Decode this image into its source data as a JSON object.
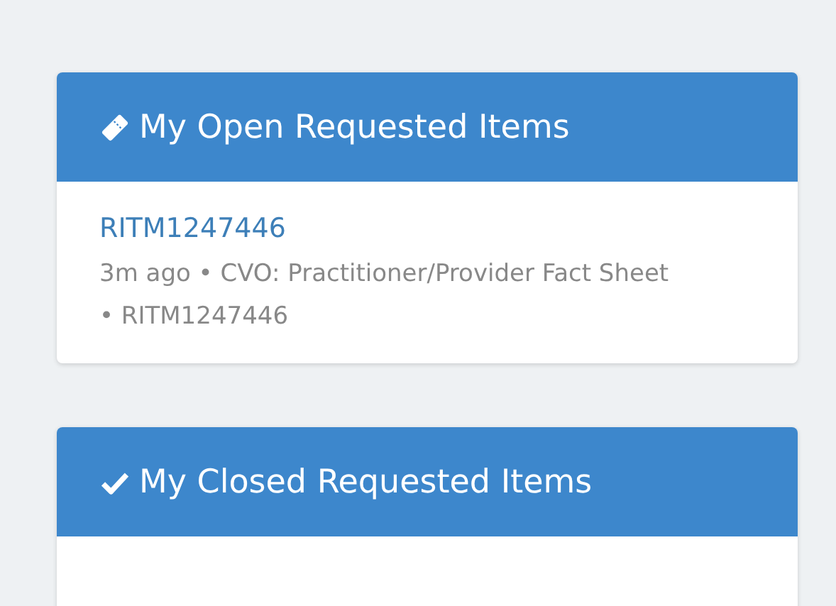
{
  "panels": [
    {
      "title": "My Open Requested Items",
      "kind": "ticket",
      "items": [
        {
          "number": "RITM1247446",
          "meta": "3m ago • CVO: Practitioner/Provider Fact Sheet • RITM1247446"
        }
      ]
    },
    {
      "title": "My Closed Requested Items",
      "kind": "check"
    }
  ]
}
